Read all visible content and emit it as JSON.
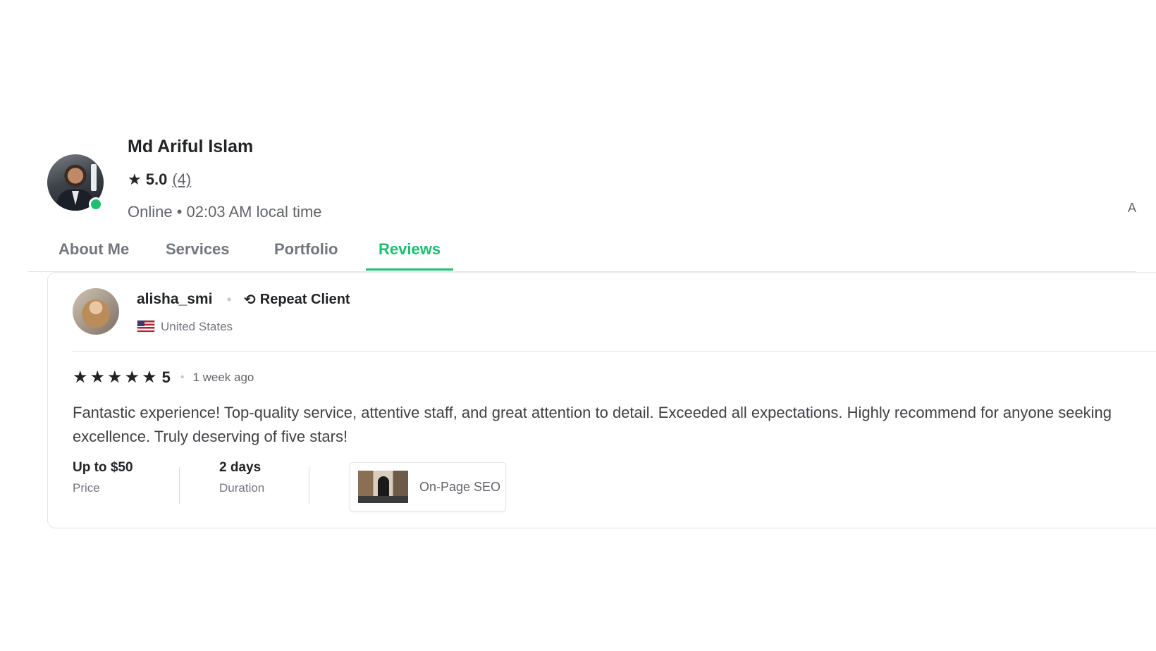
{
  "seller": {
    "name": "Md Ariful Islam",
    "rating": "5.0",
    "review_count": "(4)",
    "status": "Online • 02:03 AM local time",
    "edge_text": "A"
  },
  "tabs": [
    {
      "label": "About Me",
      "active": false
    },
    {
      "label": "Services",
      "active": false
    },
    {
      "label": "Portfolio",
      "active": false
    },
    {
      "label": "Reviews",
      "active": true
    }
  ],
  "review": {
    "reviewer": "alisha_smi",
    "badge": "Repeat Client",
    "country": "United States",
    "stars": 5,
    "score": "5",
    "time_ago": "1 week ago",
    "text": "Fantastic experience! Top-quality service, attentive staff, and great attention to detail. Exceeded all expectations. Highly recommend for anyone seeking excellence. Truly deserving of five stars!",
    "price_value": "Up to $50",
    "price_label": "Price",
    "duration_value": "2 days",
    "duration_label": "Duration",
    "gig_title": "On-Page SEO"
  },
  "colors": {
    "accent": "#1dbf73",
    "text": "#222325",
    "muted": "#62646a"
  }
}
